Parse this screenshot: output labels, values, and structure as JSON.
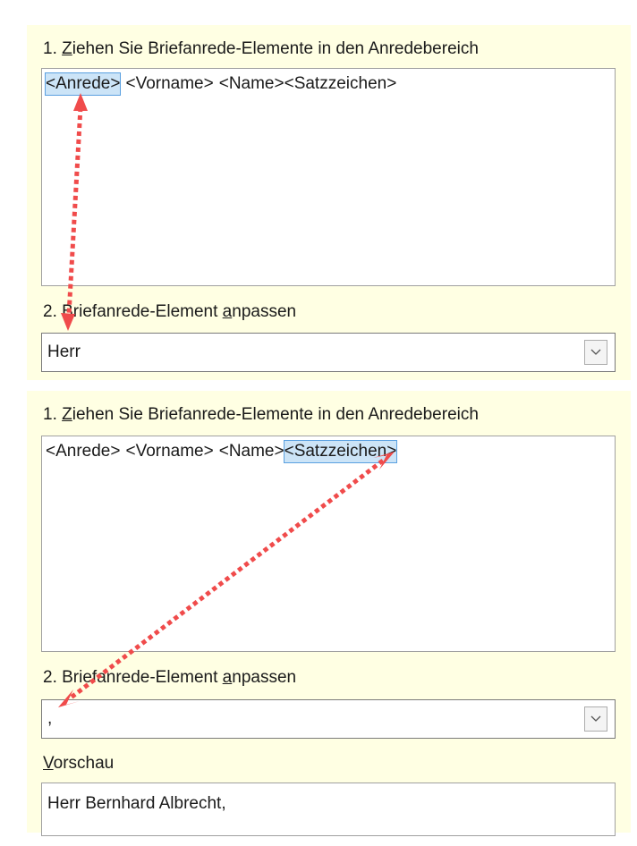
{
  "panel1": {
    "step1_prefix": "1. ",
    "step1_accel": "Z",
    "step1_rest": "iehen Sie Briefanrede-Elemente in den Anredebereich",
    "tokens": [
      "<Anrede>",
      "<Vorname>",
      "<Name>",
      "<Satzzeichen>"
    ],
    "selected_token": "<Anrede>",
    "step2_prefix": "2. Briefanrede-Element ",
    "step2_accel": "a",
    "step2_rest": "npassen",
    "dropdown_value": "Herr"
  },
  "panel2": {
    "step1_prefix": "1. ",
    "step1_accel": "Z",
    "step1_rest": "iehen Sie Briefanrede-Elemente in den Anredebereich",
    "tokens": [
      "<Anrede>",
      "<Vorname>",
      "<Name>",
      "<Satzzeichen>"
    ],
    "selected_token": "<Satzzeichen>",
    "step2_prefix": "2. Briefanrede-Element ",
    "step2_accel": "a",
    "step2_rest": "npassen",
    "dropdown_value": ",",
    "preview_accel": "V",
    "preview_rest": "orschau",
    "preview_text": "Herr Bernhard Albrecht,"
  },
  "icons": {
    "dropdown": "chevron-down-icon",
    "annotation": "double-headed-dotted-arrow-icon"
  },
  "colors": {
    "panel_background": "#ffffe3",
    "selection_fill": "#cce4f7",
    "selection_border": "#5aa0e0",
    "annotation_arrow": "#f04b4b"
  }
}
